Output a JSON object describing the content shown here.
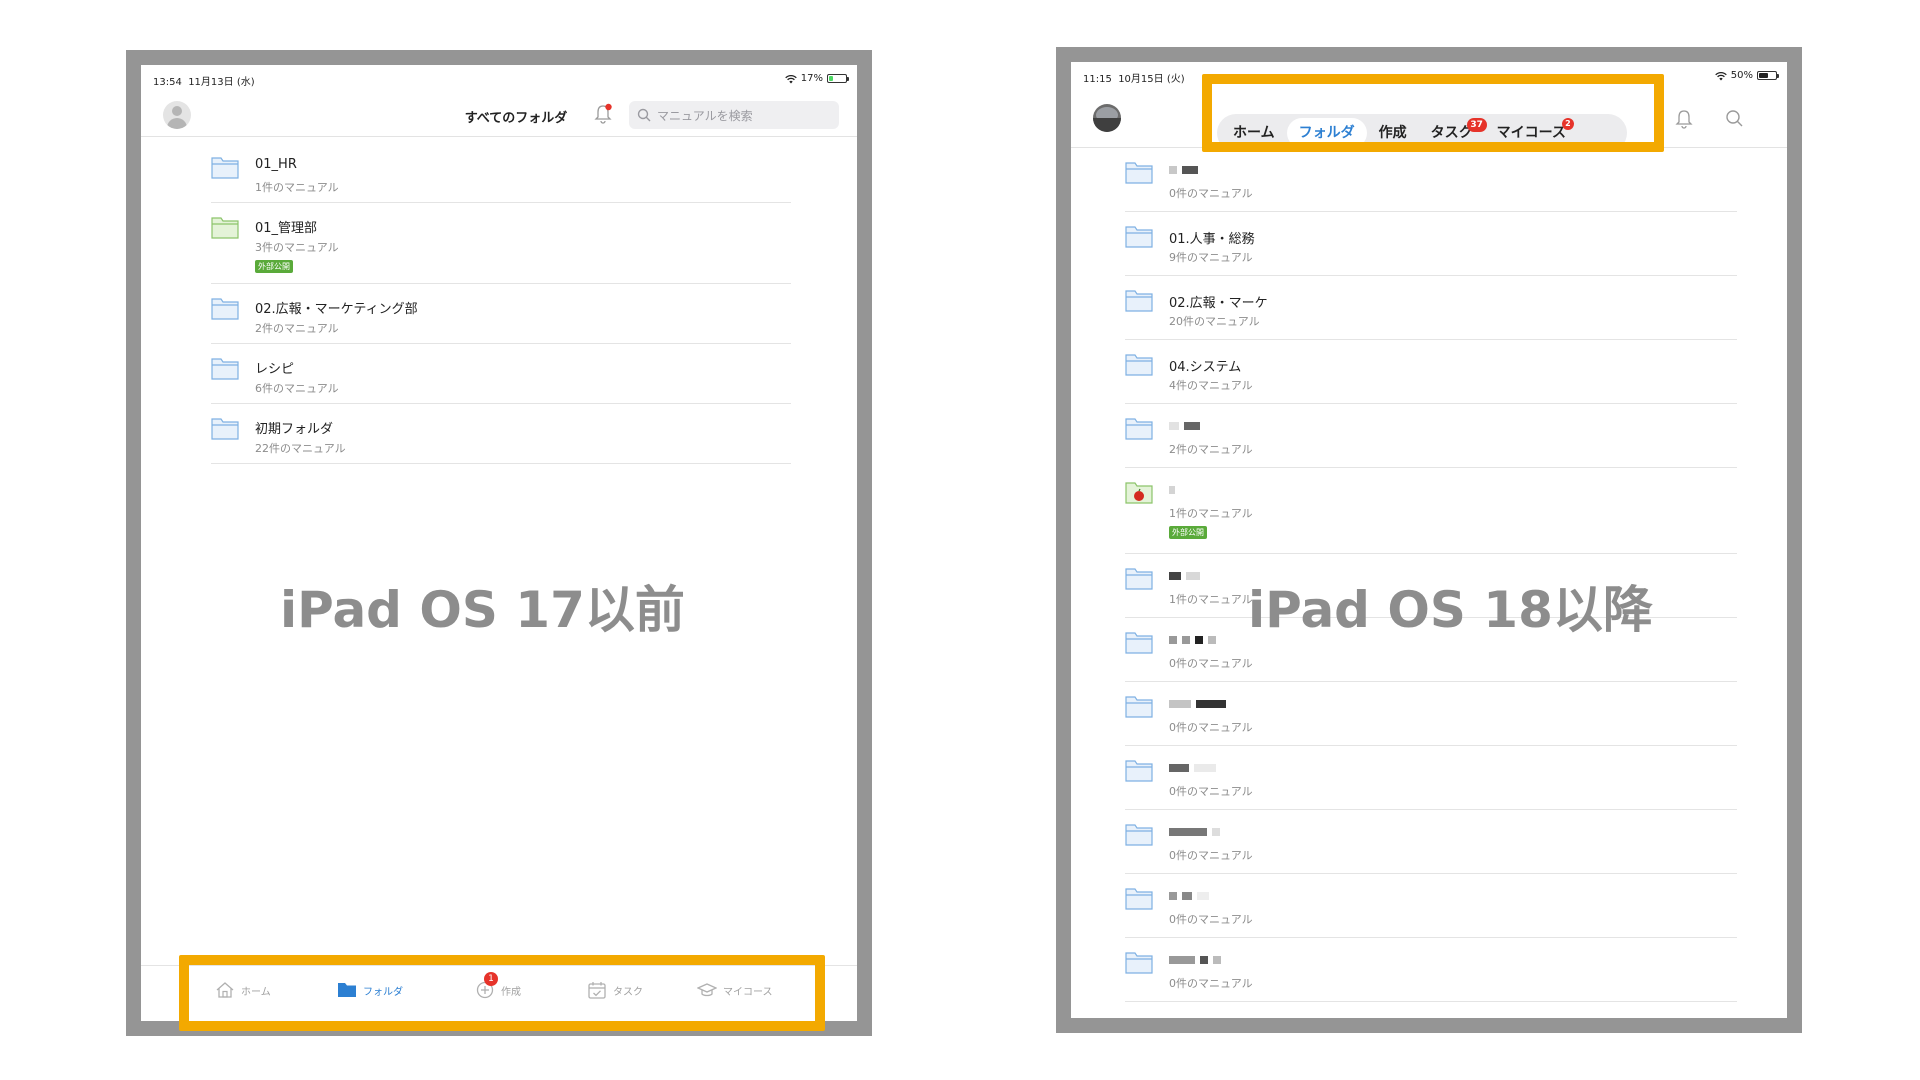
{
  "left": {
    "status": {
      "time": "13:54",
      "date": "11月13日 (水)",
      "battery": "17%"
    },
    "nav": {
      "title": "すべてのフォルダ",
      "search_placeholder": "マニュアルを検索"
    },
    "folders": [
      {
        "name": "01_HR",
        "count": "1件のマニュアル",
        "color": "blue"
      },
      {
        "name": "01_管理部",
        "count": "3件のマニュアル",
        "color": "green",
        "tag": "外部公開"
      },
      {
        "name": "02.広報・マーケティング部",
        "count": "2件のマニュアル",
        "color": "blue"
      },
      {
        "name": "レシピ",
        "count": "6件のマニュアル",
        "color": "blue"
      },
      {
        "name": "初期フォルダ",
        "count": "22件のマニュアル",
        "color": "blue"
      }
    ],
    "tabbar": {
      "home": "ホーム",
      "folder": "フォルダ",
      "create": "作成",
      "create_badge": "1",
      "task": "タスク",
      "mycourse": "マイコース"
    },
    "caption": "iPad OS 17以前"
  },
  "right": {
    "status": {
      "time": "11:15",
      "date": "10月15日 (火)",
      "battery": "50%"
    },
    "segments": {
      "home": "ホーム",
      "folder": "フォルダ",
      "create": "作成",
      "task": "タスク",
      "task_badge": "37",
      "mycourse": "マイコース",
      "mycourse_badge": "2"
    },
    "folders": [
      {
        "name": "",
        "count": "0件のマニュアル"
      },
      {
        "name": "01.人事・総務",
        "count": "9件のマニュアル"
      },
      {
        "name": "02.広報・マーケ",
        "count": "20件のマニュアル"
      },
      {
        "name": "04.システム",
        "count": "4件のマニュアル"
      },
      {
        "name": "",
        "count": "2件のマニュアル"
      },
      {
        "name": "",
        "count": "1件のマニュアル",
        "tag": "外部公開"
      },
      {
        "name": "",
        "count": "1件のマニュアル"
      },
      {
        "name": "",
        "count": "0件のマニュアル"
      },
      {
        "name": "",
        "count": "0件のマニュアル"
      },
      {
        "name": "",
        "count": "0件のマニュアル"
      },
      {
        "name": "",
        "count": "0件のマニュアル"
      },
      {
        "name": "",
        "count": "0件のマニュアル"
      },
      {
        "name": "",
        "count": "0件のマニュアル"
      }
    ],
    "caption": "iPad OS 18以降"
  },
  "colors": {
    "accent": "#2c7fd2",
    "highlight": "#f3a900",
    "frame": "#959595",
    "badge": "#e6332a",
    "tag": "#5aaa3a",
    "caption": "#8d8d8d"
  }
}
